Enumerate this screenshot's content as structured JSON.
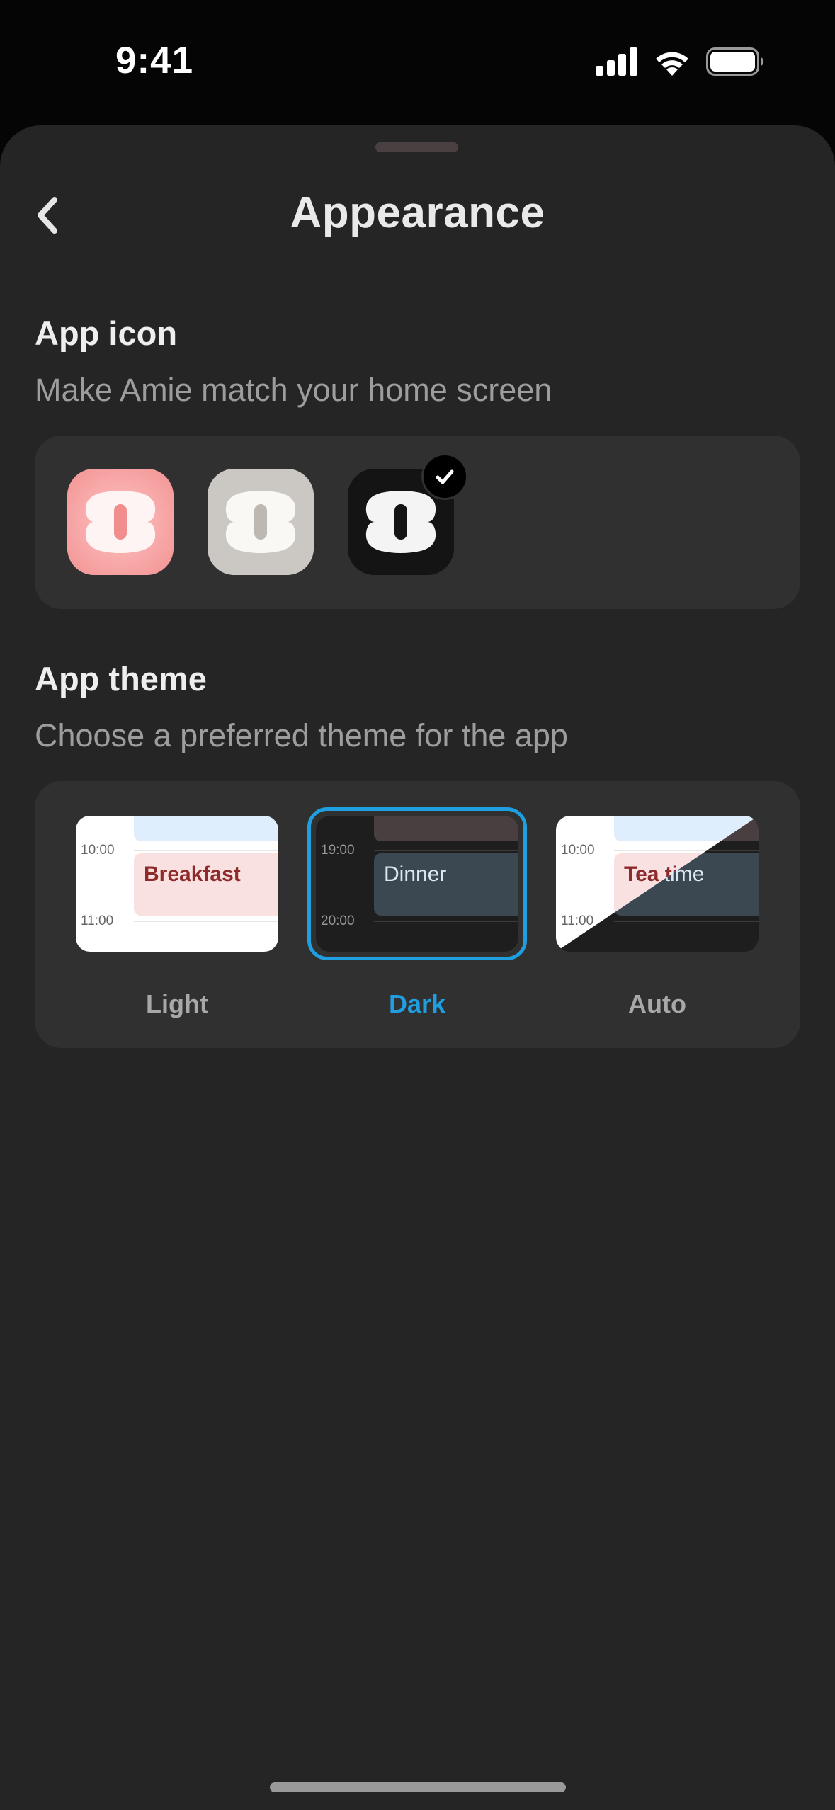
{
  "status_bar": {
    "time": "9:41"
  },
  "header": {
    "title": "Appearance"
  },
  "app_icon_section": {
    "title": "App icon",
    "subtitle": "Make Amie match your home screen",
    "icons": [
      {
        "name": "pink",
        "bg": "#f7a2a2"
      },
      {
        "name": "gray",
        "bg": "#cbc7c3"
      },
      {
        "name": "black",
        "bg": "#141414",
        "selected": true
      }
    ]
  },
  "theme_section": {
    "title": "App theme",
    "subtitle": "Choose a preferred theme for the app",
    "options": [
      {
        "label": "Light",
        "event": "Breakfast",
        "time_top": "10:00",
        "time_bottom": "11:00"
      },
      {
        "label": "Dark",
        "event": "Dinner",
        "time_top": "19:00",
        "time_bottom": "20:00",
        "selected": true
      },
      {
        "label": "Auto",
        "event": "Tea time",
        "time_top": "10:00",
        "time_bottom": "11:00"
      }
    ]
  },
  "colors": {
    "accent": "#1f9fe0",
    "background": "#252525",
    "card": "#303030"
  }
}
